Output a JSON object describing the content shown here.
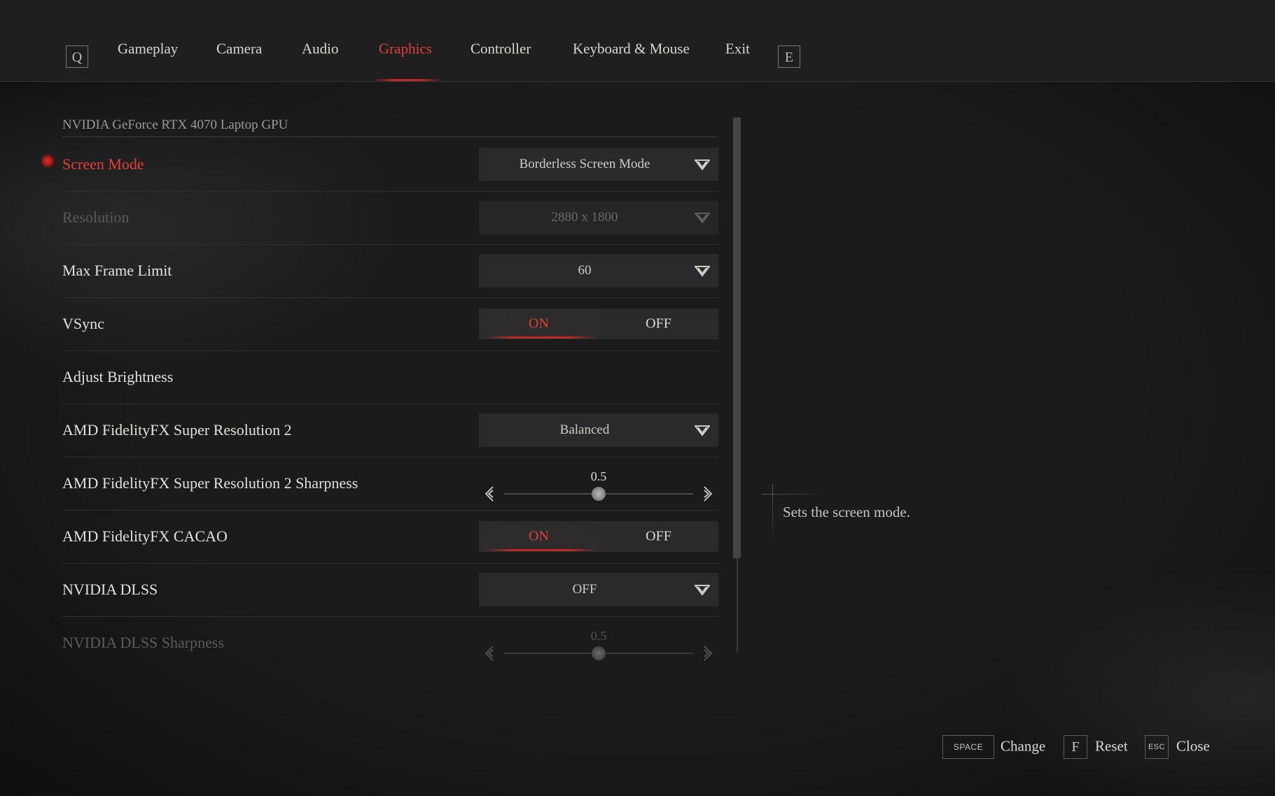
{
  "nav": {
    "prev_key": "Q",
    "next_key": "E",
    "tabs": [
      {
        "label": "Gameplay",
        "active": false
      },
      {
        "label": "Camera",
        "active": false
      },
      {
        "label": "Audio",
        "active": false
      },
      {
        "label": "Graphics",
        "active": true
      },
      {
        "label": "Controller",
        "active": false
      },
      {
        "label": "Keyboard & Mouse",
        "active": false
      },
      {
        "label": "Exit",
        "active": false
      }
    ]
  },
  "gpu_label": "NVIDIA GeForce RTX 4070 Laptop GPU",
  "settings": {
    "screen_mode": {
      "label": "Screen Mode",
      "value": "Borderless Screen Mode"
    },
    "resolution": {
      "label": "Resolution",
      "value": "2880 x 1800"
    },
    "max_frame_limit": {
      "label": "Max Frame Limit",
      "value": "60"
    },
    "vsync": {
      "label": "VSync",
      "on": "ON",
      "off": "OFF",
      "selected": "ON"
    },
    "adjust_brightness": {
      "label": "Adjust Brightness"
    },
    "fsr2": {
      "label": "AMD FidelityFX Super Resolution 2",
      "value": "Balanced"
    },
    "fsr2_sharpness": {
      "label": "AMD FidelityFX Super Resolution 2 Sharpness",
      "value": "0.5",
      "fraction": 0.5
    },
    "cacao": {
      "label": "AMD FidelityFX CACAO",
      "on": "ON",
      "off": "OFF",
      "selected": "ON"
    },
    "dlss": {
      "label": "NVIDIA DLSS",
      "value": "OFF"
    },
    "dlss_sharpness": {
      "label": "NVIDIA DLSS Sharpness",
      "value": "0.5",
      "fraction": 0.5
    }
  },
  "description": "Sets the screen mode.",
  "footer": {
    "change": {
      "key": "SPACE",
      "label": "Change"
    },
    "reset": {
      "key": "F",
      "label": "Reset"
    },
    "close": {
      "key": "ESC",
      "label": "Close"
    }
  },
  "colors": {
    "accent": "#e0403a",
    "background": "#1b1b1c",
    "text": "#d9d6cf"
  }
}
